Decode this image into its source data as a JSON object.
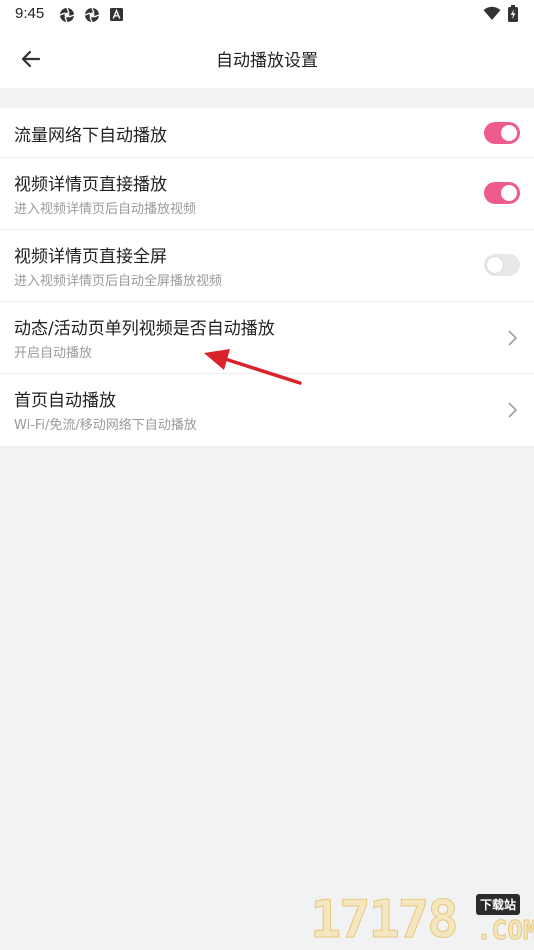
{
  "status_bar": {
    "time": "9:45",
    "icons": [
      "aperture-icon",
      "aperture-icon",
      "app-notification-icon",
      "wifi-icon",
      "battery-charging-icon"
    ]
  },
  "app_bar": {
    "title": "自动播放设置",
    "back_icon": "arrow-left-icon"
  },
  "settings": [
    {
      "title": "流量网络下自动播放",
      "subtitle": "",
      "control": "toggle",
      "enabled": true
    },
    {
      "title": "视频详情页直接播放",
      "subtitle": "进入视频详情页后自动播放视频",
      "control": "toggle",
      "enabled": true
    },
    {
      "title": "视频详情页直接全屏",
      "subtitle": "进入视频详情页后自动全屏播放视频",
      "control": "toggle",
      "enabled": false
    },
    {
      "title": "动态/活动页单列视频是否自动播放",
      "subtitle": "开启自动播放",
      "control": "chevron"
    },
    {
      "title": "首页自动播放",
      "subtitle": "Wi-Fi/免流/移动网络下自动播放",
      "control": "chevron"
    }
  ],
  "colors": {
    "toggle_on": "#ee5c8c",
    "toggle_off": "#e8e8e8",
    "annotation_arrow": "#d9222a",
    "background": "#f1f2f4"
  },
  "watermark": {
    "number": "17178",
    "tag": "下载站",
    "suffix": ".COM"
  }
}
